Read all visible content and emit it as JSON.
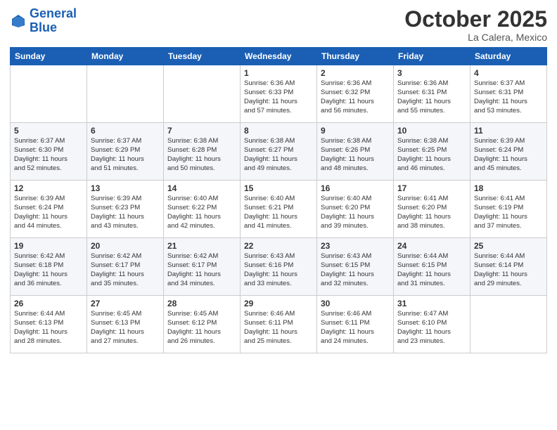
{
  "header": {
    "logo_line1": "General",
    "logo_line2": "Blue",
    "month": "October 2025",
    "location": "La Calera, Mexico"
  },
  "weekdays": [
    "Sunday",
    "Monday",
    "Tuesday",
    "Wednesday",
    "Thursday",
    "Friday",
    "Saturday"
  ],
  "weeks": [
    [
      {
        "day": "",
        "info": ""
      },
      {
        "day": "",
        "info": ""
      },
      {
        "day": "",
        "info": ""
      },
      {
        "day": "1",
        "info": "Sunrise: 6:36 AM\nSunset: 6:33 PM\nDaylight: 11 hours\nand 57 minutes."
      },
      {
        "day": "2",
        "info": "Sunrise: 6:36 AM\nSunset: 6:32 PM\nDaylight: 11 hours\nand 56 minutes."
      },
      {
        "day": "3",
        "info": "Sunrise: 6:36 AM\nSunset: 6:31 PM\nDaylight: 11 hours\nand 55 minutes."
      },
      {
        "day": "4",
        "info": "Sunrise: 6:37 AM\nSunset: 6:31 PM\nDaylight: 11 hours\nand 53 minutes."
      }
    ],
    [
      {
        "day": "5",
        "info": "Sunrise: 6:37 AM\nSunset: 6:30 PM\nDaylight: 11 hours\nand 52 minutes."
      },
      {
        "day": "6",
        "info": "Sunrise: 6:37 AM\nSunset: 6:29 PM\nDaylight: 11 hours\nand 51 minutes."
      },
      {
        "day": "7",
        "info": "Sunrise: 6:38 AM\nSunset: 6:28 PM\nDaylight: 11 hours\nand 50 minutes."
      },
      {
        "day": "8",
        "info": "Sunrise: 6:38 AM\nSunset: 6:27 PM\nDaylight: 11 hours\nand 49 minutes."
      },
      {
        "day": "9",
        "info": "Sunrise: 6:38 AM\nSunset: 6:26 PM\nDaylight: 11 hours\nand 48 minutes."
      },
      {
        "day": "10",
        "info": "Sunrise: 6:38 AM\nSunset: 6:25 PM\nDaylight: 11 hours\nand 46 minutes."
      },
      {
        "day": "11",
        "info": "Sunrise: 6:39 AM\nSunset: 6:24 PM\nDaylight: 11 hours\nand 45 minutes."
      }
    ],
    [
      {
        "day": "12",
        "info": "Sunrise: 6:39 AM\nSunset: 6:24 PM\nDaylight: 11 hours\nand 44 minutes."
      },
      {
        "day": "13",
        "info": "Sunrise: 6:39 AM\nSunset: 6:23 PM\nDaylight: 11 hours\nand 43 minutes."
      },
      {
        "day": "14",
        "info": "Sunrise: 6:40 AM\nSunset: 6:22 PM\nDaylight: 11 hours\nand 42 minutes."
      },
      {
        "day": "15",
        "info": "Sunrise: 6:40 AM\nSunset: 6:21 PM\nDaylight: 11 hours\nand 41 minutes."
      },
      {
        "day": "16",
        "info": "Sunrise: 6:40 AM\nSunset: 6:20 PM\nDaylight: 11 hours\nand 39 minutes."
      },
      {
        "day": "17",
        "info": "Sunrise: 6:41 AM\nSunset: 6:20 PM\nDaylight: 11 hours\nand 38 minutes."
      },
      {
        "day": "18",
        "info": "Sunrise: 6:41 AM\nSunset: 6:19 PM\nDaylight: 11 hours\nand 37 minutes."
      }
    ],
    [
      {
        "day": "19",
        "info": "Sunrise: 6:42 AM\nSunset: 6:18 PM\nDaylight: 11 hours\nand 36 minutes."
      },
      {
        "day": "20",
        "info": "Sunrise: 6:42 AM\nSunset: 6:17 PM\nDaylight: 11 hours\nand 35 minutes."
      },
      {
        "day": "21",
        "info": "Sunrise: 6:42 AM\nSunset: 6:17 PM\nDaylight: 11 hours\nand 34 minutes."
      },
      {
        "day": "22",
        "info": "Sunrise: 6:43 AM\nSunset: 6:16 PM\nDaylight: 11 hours\nand 33 minutes."
      },
      {
        "day": "23",
        "info": "Sunrise: 6:43 AM\nSunset: 6:15 PM\nDaylight: 11 hours\nand 32 minutes."
      },
      {
        "day": "24",
        "info": "Sunrise: 6:44 AM\nSunset: 6:15 PM\nDaylight: 11 hours\nand 31 minutes."
      },
      {
        "day": "25",
        "info": "Sunrise: 6:44 AM\nSunset: 6:14 PM\nDaylight: 11 hours\nand 29 minutes."
      }
    ],
    [
      {
        "day": "26",
        "info": "Sunrise: 6:44 AM\nSunset: 6:13 PM\nDaylight: 11 hours\nand 28 minutes."
      },
      {
        "day": "27",
        "info": "Sunrise: 6:45 AM\nSunset: 6:13 PM\nDaylight: 11 hours\nand 27 minutes."
      },
      {
        "day": "28",
        "info": "Sunrise: 6:45 AM\nSunset: 6:12 PM\nDaylight: 11 hours\nand 26 minutes."
      },
      {
        "day": "29",
        "info": "Sunrise: 6:46 AM\nSunset: 6:11 PM\nDaylight: 11 hours\nand 25 minutes."
      },
      {
        "day": "30",
        "info": "Sunrise: 6:46 AM\nSunset: 6:11 PM\nDaylight: 11 hours\nand 24 minutes."
      },
      {
        "day": "31",
        "info": "Sunrise: 6:47 AM\nSunset: 6:10 PM\nDaylight: 11 hours\nand 23 minutes."
      },
      {
        "day": "",
        "info": ""
      }
    ]
  ]
}
